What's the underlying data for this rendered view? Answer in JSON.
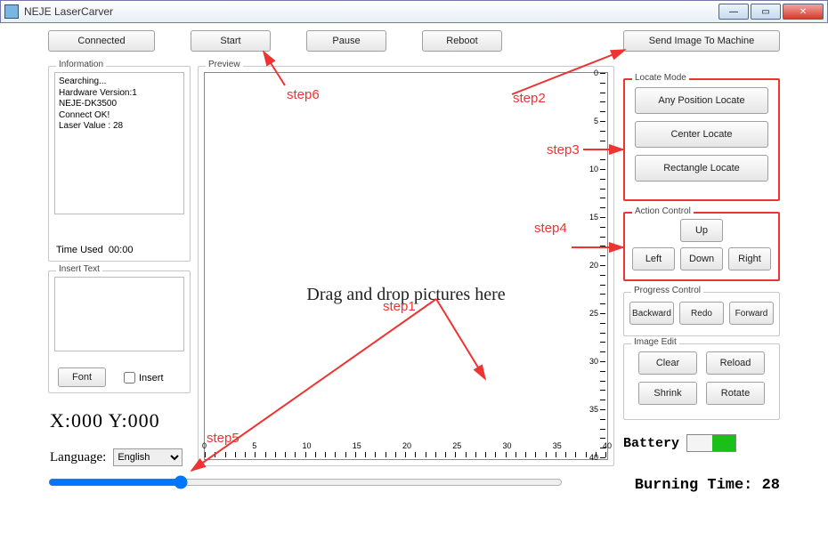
{
  "window": {
    "title": "NEJE LaserCarver"
  },
  "top_buttons": {
    "connected": "Connected",
    "start": "Start",
    "pause": "Pause",
    "reboot": "Reboot",
    "send": "Send Image To Machine"
  },
  "info": {
    "group_label": "Information",
    "text": "Searching...\nHardware Version:1\nNEJE-DK3500\nConnect OK!\nLaser Value : 28",
    "time_used_label": "Time Used",
    "time_used_value": "00:00"
  },
  "insert": {
    "group_label": "Insert Text",
    "font_label": "Font",
    "checkbox_label": "Insert"
  },
  "coords": {
    "text": "X:000   Y:000"
  },
  "language": {
    "label": "Language:",
    "selected": "English",
    "options": [
      "English"
    ]
  },
  "preview": {
    "group_label": "Preview",
    "drop_hint": "Drag and drop pictures here",
    "ruler_max": 40,
    "ruler_step": 5
  },
  "locate": {
    "group_label": "Locate Mode",
    "any": "Any Position Locate",
    "center": "Center Locate",
    "rect": "Rectangle Locate"
  },
  "action": {
    "group_label": "Action Control",
    "up": "Up",
    "left": "Left",
    "down": "Down",
    "right": "Right"
  },
  "progress": {
    "group_label": "Progress Control",
    "backward": "Backward",
    "redo": "Redo",
    "forward": "Forward"
  },
  "edit": {
    "group_label": "Image Edit",
    "clear": "Clear",
    "reload": "Reload",
    "shrink": "Shrink",
    "rotate": "Rotate"
  },
  "battery": {
    "label": "Battery"
  },
  "burning": {
    "label": "Burning Time:",
    "value": "28"
  },
  "annotations": {
    "step1": "step1",
    "step2": "step2",
    "step3": "step3",
    "step4": "step4",
    "step5": "step5",
    "step6": "step6"
  }
}
